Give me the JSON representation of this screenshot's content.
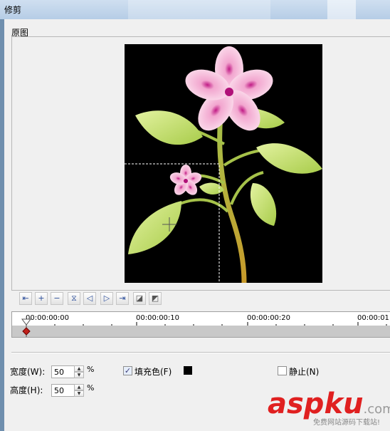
{
  "window": {
    "title": "修剪"
  },
  "preview_group": {
    "label": "原图"
  },
  "toolbar": {
    "buttons": [
      "go-start-icon",
      "add-keyframe-icon",
      "remove-keyframe-icon",
      "flip-icon",
      "prev-keyframe-icon",
      "next-keyframe-icon",
      "go-end-icon",
      "copy-icon",
      "paste-icon"
    ]
  },
  "timeline": {
    "ticks": [
      "00:00:00:00",
      "00:00:00:10",
      "00:00:00:20",
      "00:00:01"
    ]
  },
  "size": {
    "width_label": "宽度(W):",
    "width_value": "50",
    "height_label": "高度(H):",
    "height_value": "50",
    "unit": "%"
  },
  "fill": {
    "label": "填充色(F)",
    "checked": true,
    "color": "#000000"
  },
  "still": {
    "label": "静止(N)",
    "checked": false
  },
  "watermark": {
    "brand_main": "asp",
    "brand_ku": "ku",
    "brand_com": ".com",
    "tagline": "免费网站源码下载站!"
  }
}
